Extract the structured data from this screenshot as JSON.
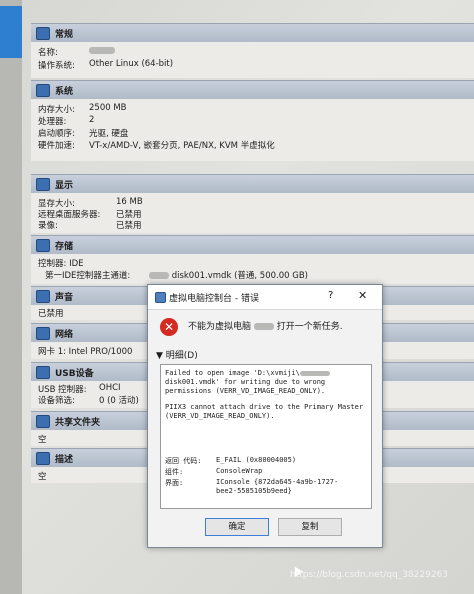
{
  "sections": {
    "general": {
      "title": "常规",
      "name_label": "名称:",
      "os_label": "操作系统:",
      "os_value": "Other Linux (64-bit)"
    },
    "system": {
      "title": "系统",
      "rows": [
        {
          "k": "内存大小:",
          "v": "2500 MB"
        },
        {
          "k": "处理器:",
          "v": "2"
        },
        {
          "k": "启动顺序:",
          "v": "光驱, 硬盘"
        },
        {
          "k": "硬件加速:",
          "v": "VT-x/AMD-V, 嵌套分页, PAE/NX, KVM 半虚拟化"
        }
      ]
    },
    "display": {
      "title": "显示",
      "rows": [
        {
          "k": "显存大小:",
          "v": "16 MB"
        },
        {
          "k": "远程桌面服务器:",
          "v": "已禁用"
        },
        {
          "k": "录像:",
          "v": "已禁用"
        }
      ]
    },
    "storage": {
      "title": "存储",
      "controller": "控制器: IDE",
      "ide_label": "第一IDE控制器主通道:",
      "ide_value": "disk001.vmdk (普通, 500.00 GB)"
    },
    "audio": {
      "title": "声音",
      "value": "已禁用"
    },
    "network": {
      "title": "网络",
      "value": "网卡 1:  Intel PRO/1000"
    },
    "usb": {
      "title": "USB设备",
      "controller_label": "USB 控制器:",
      "controller_value": "OHCI",
      "filter_label": "设备筛选:",
      "filter_value": "0 (0 活动)"
    },
    "shared": {
      "title": "共享文件夹",
      "value": "空"
    },
    "description": {
      "title": "描述",
      "value": "空"
    }
  },
  "dialog": {
    "title": "虚拟电脑控制台 - 错误",
    "help": "?",
    "close": "✕",
    "message_prefix": "不能为虚拟电脑",
    "message_suffix": "打开一个新任务.",
    "details_toggle": "明细(D)",
    "details": {
      "line1": "Failed to open image 'D:\\xvmiji\\",
      "line2": "disk001.vmdk' for writing due to wrong",
      "line3": "permissions (VERR_VD_IMAGE_READ_ONLY).",
      "line4": "PIIX3 cannot attach drive to the Primary Master",
      "line5": "(VERR_VD_IMAGE_READ_ONLY).",
      "code_label": "返回  代码:",
      "code_value": "E_FAIL (0x80004005)",
      "component_label": "组件:",
      "component_value": "ConsoleWrap",
      "interface_label": "界面:",
      "interface_value": "IConsole {872da645-4a9b-1727-",
      "interface_value2": "bee2-5585105b9eed}"
    },
    "ok_button": "确定",
    "copy_button": "复制"
  },
  "watermark": "https://blog.csdn.net/qq_38229263"
}
